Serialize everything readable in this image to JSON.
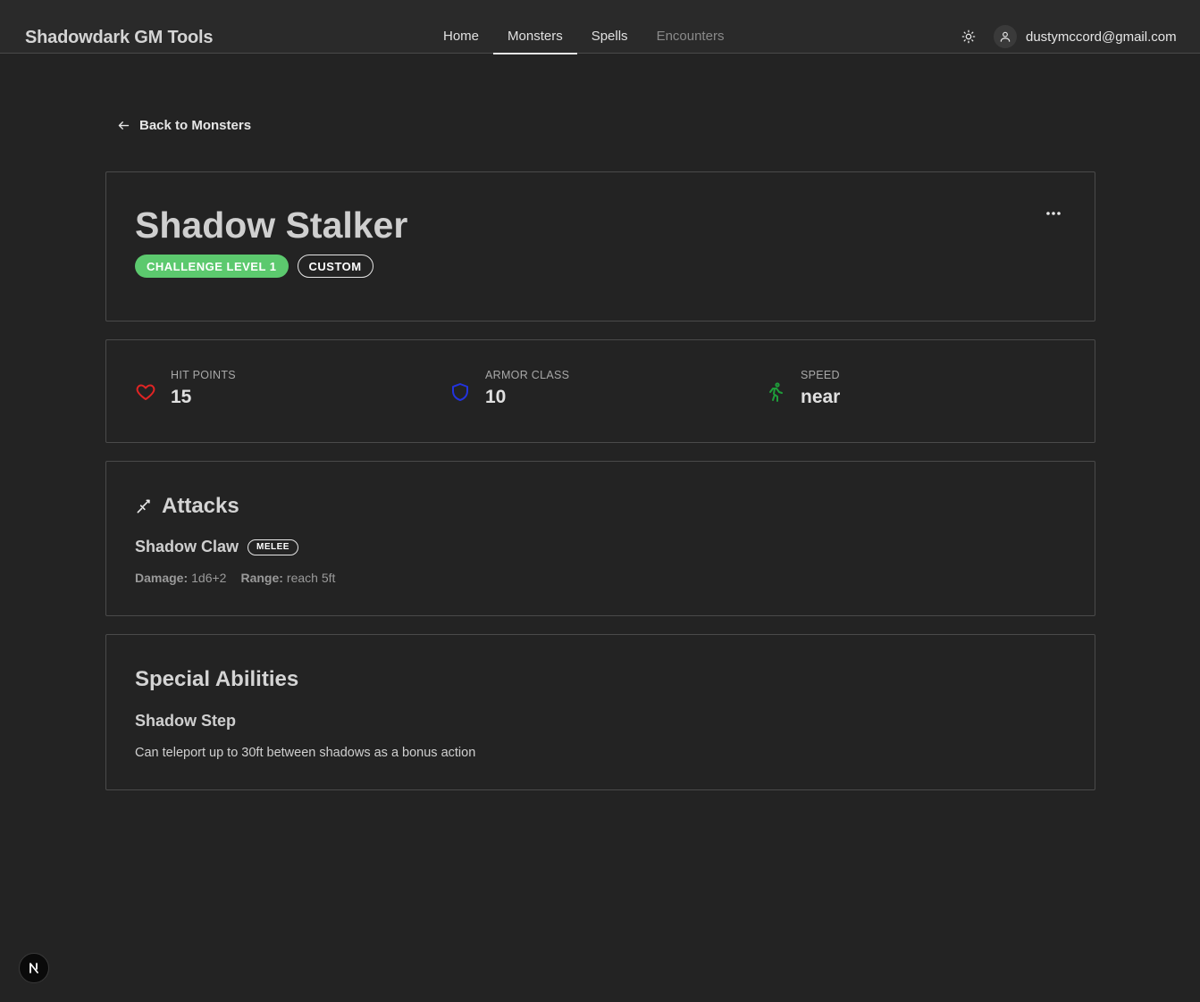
{
  "app": {
    "brand": "Shadowdark GM Tools"
  },
  "nav": {
    "items": [
      {
        "label": "Home"
      },
      {
        "label": "Monsters"
      },
      {
        "label": "Spells"
      },
      {
        "label": "Encounters"
      }
    ],
    "active": "Monsters"
  },
  "user": {
    "email": "dustymccord@gmail.com",
    "theme_icon": "sun-icon",
    "avatar_icon": "user-icon"
  },
  "back": {
    "label": "Back to Monsters",
    "icon": "arrow-left-icon"
  },
  "monster": {
    "name": "Shadow Stalker",
    "challenge_badge": "CHALLENGE LEVEL 1",
    "custom_badge": "CUSTOM",
    "menu_icon": "more-horizontal-icon"
  },
  "stats": [
    {
      "label": "HIT POINTS",
      "value": "15",
      "icon": "heart-icon",
      "color": "#e02424"
    },
    {
      "label": "ARMOR CLASS",
      "value": "10",
      "icon": "shield-icon",
      "color": "#2233dd"
    },
    {
      "label": "SPEED",
      "value": "near",
      "icon": "running-icon",
      "color": "#1f9d3a"
    }
  ],
  "attacks": {
    "title": "Attacks",
    "icon": "sword-icon",
    "items": [
      {
        "name": "Shadow Claw",
        "type": "MELEE",
        "damage_label": "Damage:",
        "damage": "1d6+2",
        "range_label": "Range:",
        "range": "reach 5ft"
      }
    ]
  },
  "abilities": {
    "title": "Special Abilities",
    "items": [
      {
        "name": "Shadow Step",
        "description": "Can teleport up to 30ft between shadows as a bonus action"
      }
    ]
  },
  "colors": {
    "background": "#232323",
    "challenge_badge": "#5cc96e"
  },
  "dev_badge": {
    "label": "N"
  }
}
